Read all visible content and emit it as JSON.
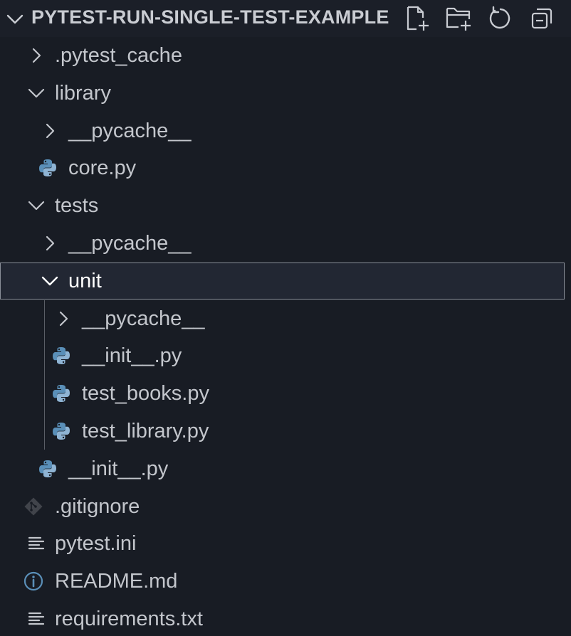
{
  "explorer": {
    "title": "PYTEST-RUN-SINGLE-TEST-EXAMPLE",
    "actions": [
      "new-file-icon",
      "new-folder-icon",
      "refresh-icon",
      "collapse-all-icon"
    ]
  },
  "tree": [
    {
      "label": ".pytest_cache",
      "kind": "folder",
      "expanded": false,
      "depth": 0
    },
    {
      "label": "library",
      "kind": "folder",
      "expanded": true,
      "depth": 0
    },
    {
      "label": "__pycache__",
      "kind": "folder",
      "expanded": false,
      "depth": 1
    },
    {
      "label": "core.py",
      "kind": "python",
      "depth": 1
    },
    {
      "label": "tests",
      "kind": "folder",
      "expanded": true,
      "depth": 0
    },
    {
      "label": "__pycache__",
      "kind": "folder",
      "expanded": false,
      "depth": 1
    },
    {
      "label": "unit",
      "kind": "folder",
      "expanded": true,
      "depth": 1,
      "selected": true
    },
    {
      "label": "__pycache__",
      "kind": "folder",
      "expanded": false,
      "depth": 2
    },
    {
      "label": "__init__.py",
      "kind": "python",
      "depth": 2
    },
    {
      "label": "test_books.py",
      "kind": "python",
      "depth": 2
    },
    {
      "label": "test_library.py",
      "kind": "python",
      "depth": 2
    },
    {
      "label": "__init__.py",
      "kind": "python",
      "depth": 1
    },
    {
      "label": ".gitignore",
      "kind": "git",
      "depth": 0
    },
    {
      "label": "pytest.ini",
      "kind": "text",
      "depth": 0
    },
    {
      "label": "README.md",
      "kind": "info",
      "depth": 0
    },
    {
      "label": "requirements.txt",
      "kind": "text",
      "depth": 0
    }
  ],
  "colors": {
    "background": "#181c24",
    "python_blue": "#5a8fb8",
    "python_light": "#8fb4d4",
    "selection_border": "#8a8f99"
  }
}
